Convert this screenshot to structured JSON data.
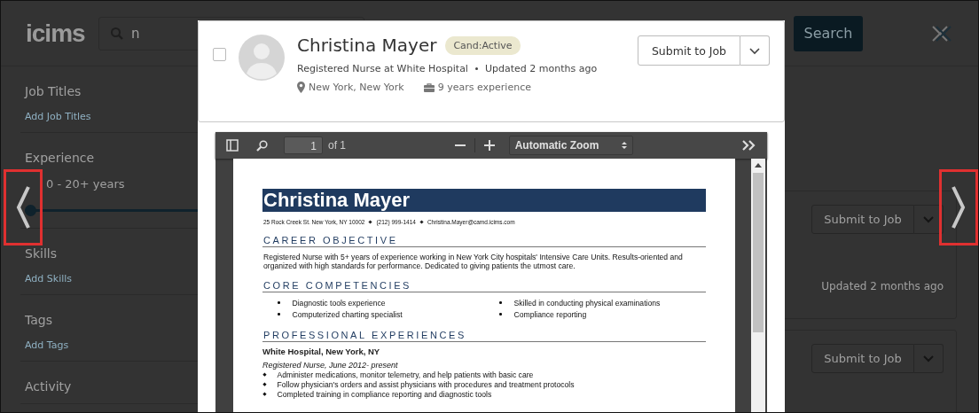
{
  "header": {
    "logo": "icims",
    "search": {
      "value": "n"
    },
    "search_button": "Search"
  },
  "sidebar": [
    {
      "kind": "link",
      "title": "Job Titles",
      "link": "Add Job Titles"
    },
    {
      "kind": "range",
      "title": "Experience",
      "range": "0 - 20+ years",
      "level": 1
    },
    {
      "kind": "link",
      "title": "Skills",
      "link": "Add Skills"
    },
    {
      "kind": "link",
      "title": "Tags",
      "link": "Add Tags"
    },
    {
      "kind": "title",
      "title": "Activity"
    }
  ],
  "results": [
    {
      "button": "Submit to Job",
      "updated": "Updated 2 months ago"
    },
    {
      "button": "Submit to Job"
    }
  ],
  "modal": {
    "candidate": {
      "checked": false,
      "name": "Christina Mayer",
      "status": "Cand:Active",
      "headline": "Registered Nurse at White Hospital",
      "updated": "Updated 2 months ago",
      "location": "New York, New York",
      "experience": "9 years experience"
    },
    "submit_button": "Submit to Job",
    "viewer": {
      "page": "1",
      "page_count": "of 1",
      "zoom": "Automatic Zoom"
    },
    "resume": {
      "name": "Christina Mayer",
      "contact": [
        "25 Rock Creek St. New York, NY 10002",
        "(212) 999-1414",
        "Christina.Mayer@camd.icims.com"
      ],
      "sections": [
        {
          "kind": "paragraph",
          "heading": "CAREER OBJECTIVE",
          "text": "Registered Nurse with 5+ years of experience working in New York City hospitals' Intensive Care Units. Results-oriented and organized with high standards for performance. Dedicated to giving patients the utmost care."
        },
        {
          "kind": "columns",
          "heading": "CORE COMPETENCIES",
          "items": [
            "Diagnostic tools experience",
            "Computerized charting specialist",
            "Skilled in conducting physical examinations",
            "Compliance reporting"
          ]
        },
        {
          "kind": "job",
          "heading": "PROFESSIONAL EXPERIENCES",
          "employer": "White Hospital, New York, NY",
          "role": "Registered Nurse, June 2012- present",
          "items": [
            "Administer medications, monitor telemetry, and help patients with basic care",
            "Follow physician's orders and assist physicians with procedures and treatment protocols",
            "Completed training in compliance reporting and diagnostic tools"
          ]
        }
      ]
    }
  }
}
